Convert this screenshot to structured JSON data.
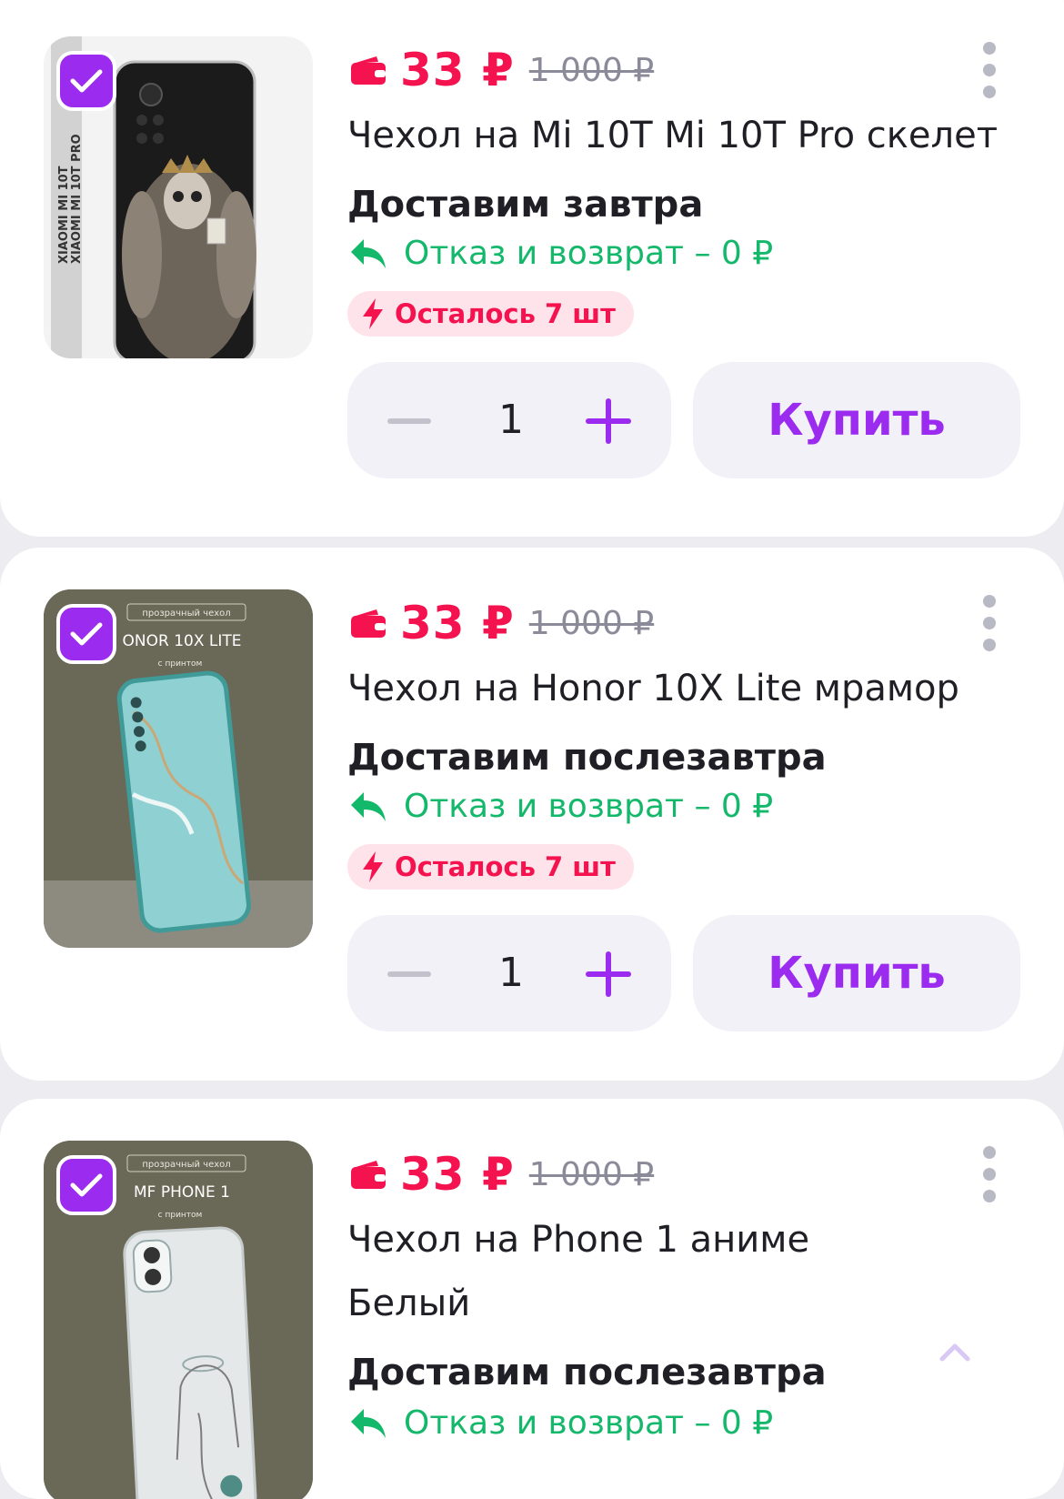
{
  "products": [
    {
      "price": "33 ₽",
      "old_price": "1 000 ₽",
      "title": "Чехол на Mi 10T Mi 10T Pro скелет",
      "delivery": "Доставим завтра",
      "return_text": "Отказ и возврат – 0 ₽",
      "stock": "Осталось 7 шт",
      "quantity": "1",
      "buy_label": "Купить",
      "image_side_text_1": "XIAOMI MI 10T",
      "image_side_text_2": "XIAOMI MI 10T PRO"
    },
    {
      "price": "33 ₽",
      "old_price": "1 000 ₽",
      "title": "Чехол на Honor 10X Lite мрамор",
      "delivery": "Доставим послезавтра",
      "return_text": "Отказ и возврат – 0 ₽",
      "stock": "Осталось 7 шт",
      "quantity": "1",
      "buy_label": "Купить",
      "image_tag": "прозрачный чехол",
      "image_model": "ONOR 10X LITE",
      "image_sub": "с принтом"
    },
    {
      "price": "33 ₽",
      "old_price": "1 000 ₽",
      "title": "Чехол на Phone 1 аниме",
      "variant": "Белый",
      "delivery": "Доставим послезавтра",
      "return_text": "Отказ и возврат – 0 ₽",
      "image_tag": "прозрачный чехол",
      "image_model": "MF PHONE 1",
      "image_sub": "с принтом"
    }
  ],
  "icons": {
    "checkbox": "checkbox-checked-icon",
    "wallet": "wallet-icon",
    "return": "return-arrow-icon",
    "bolt": "lightning-icon",
    "more": "more-vertical-icon",
    "scroll_top": "chevron-up-icon"
  },
  "colors": {
    "accent": "#9b2bef",
    "price": "#f5134f",
    "return": "#14b86a",
    "stock_bg": "#ffe3ea"
  }
}
